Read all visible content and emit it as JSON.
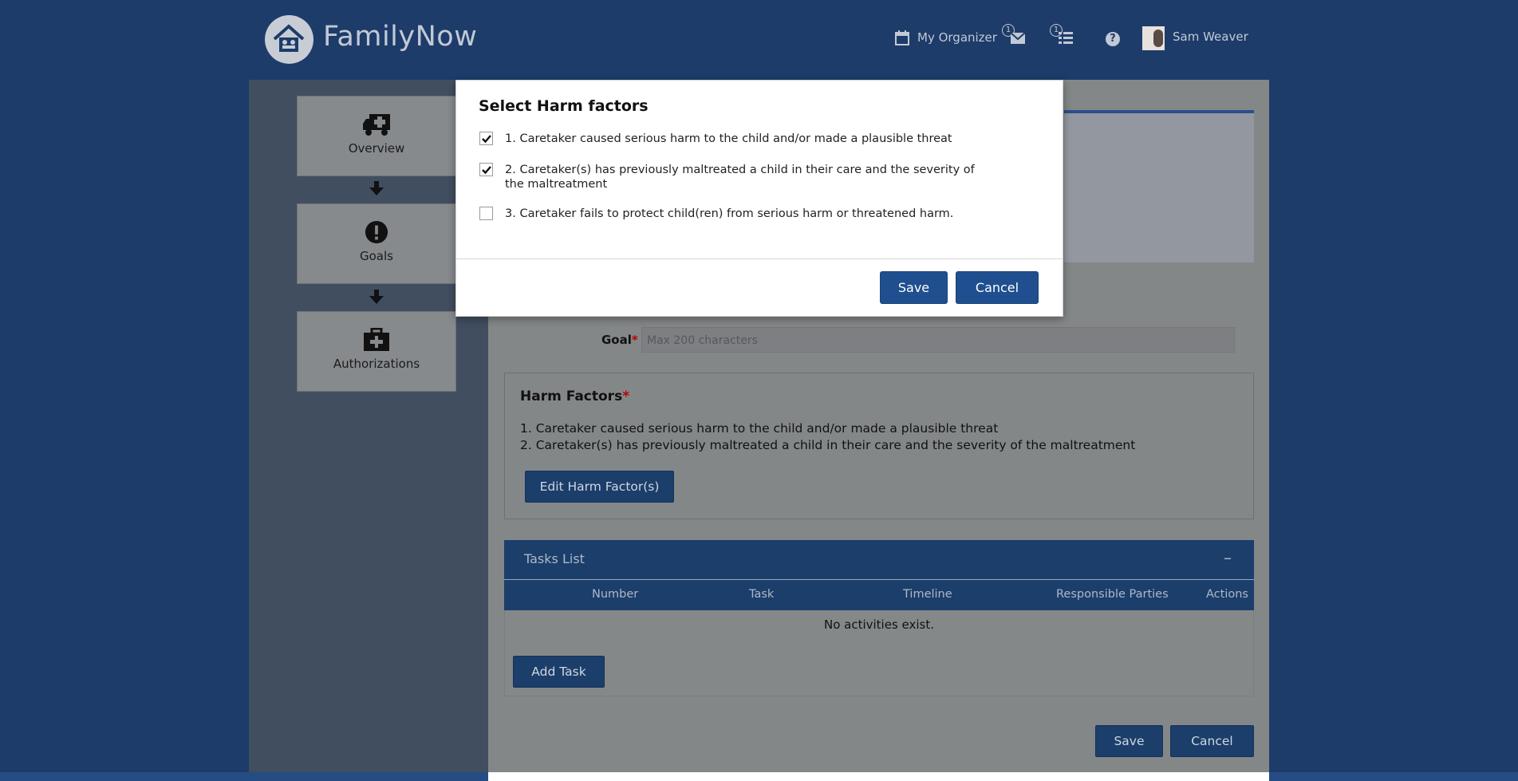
{
  "header": {
    "app_name": "FamilyNow",
    "organizer_label": "My Organizer",
    "messages_count": "1",
    "tasks_count": "1",
    "help_icon": "question-icon",
    "user_name": "Sam Weaver"
  },
  "sidebar": {
    "items": [
      {
        "label": "Overview",
        "icon": "ambulance-icon"
      },
      {
        "label": "Goals",
        "icon": "exclamation-icon"
      },
      {
        "label": "Authorizations",
        "icon": "medkit-icon"
      }
    ]
  },
  "form": {
    "goal_label": "Goal",
    "required_mark": "*",
    "goal_placeholder": "Max 200 characters",
    "harm_title": "Harm Factors",
    "harm_lines": [
      "1. Caretaker caused serious harm to the child and/or made a plausible threat",
      "2. Caretaker(s) has previously maltreated a child in their care and the severity of the maltreatment"
    ],
    "edit_harm_button": "Edit Harm Factor(s)",
    "tasks_title": "Tasks List",
    "collapse_symbol": "–",
    "columns": [
      "Number",
      "Task",
      "Timeline",
      "Responsible Parties",
      "Actions"
    ],
    "empty_message": "No activities exist.",
    "add_task_button": "Add Task",
    "save_button": "Save",
    "cancel_button": "Cancel"
  },
  "modal": {
    "title": "Select Harm factors",
    "options": [
      {
        "label": "1. Caretaker caused serious harm to the child and/or made a plausible threat",
        "checked": true
      },
      {
        "label": "2. Caretaker(s) has previously maltreated a child in their care and the severity of the maltreatment",
        "checked": true
      },
      {
        "label": "3. Caretaker fails to protect child(ren) from serious harm or threatened harm.",
        "checked": false
      }
    ],
    "save_button": "Save",
    "cancel_button": "Cancel"
  },
  "colors": {
    "header_bg": "#1d3c6a",
    "primary_button": "#1f4f8e",
    "overlay_content": "#848788"
  }
}
